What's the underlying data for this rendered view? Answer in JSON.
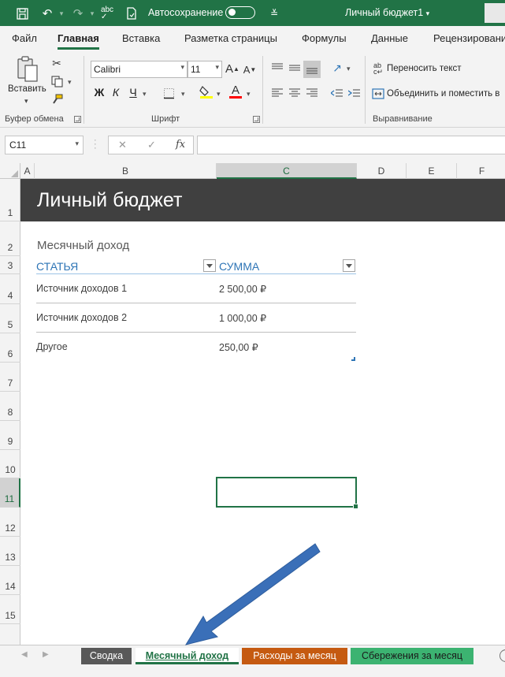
{
  "titlebar": {
    "autosave_label": "Автосохранение",
    "doc_title": "Личный бюджет1",
    "doc_title_chevron": "▾"
  },
  "ribbon_tabs": [
    "Файл",
    "Главная",
    "Вставка",
    "Разметка страницы",
    "Формулы",
    "Данные",
    "Рецензирование"
  ],
  "clipboard": {
    "paste_label": "Вставить",
    "group_label": "Буфер обмена"
  },
  "font": {
    "font_name": "Calibri",
    "font_size": "11",
    "grow": "A",
    "shrink": "A",
    "bold": "Ж",
    "italic": "К",
    "underline": "Ч",
    "group_label": "Шрифт",
    "fill_color": "#ffff00",
    "text_color": "#ff0000"
  },
  "alignment": {
    "wrap_text": "Переносить текст",
    "merge_center": "Объединить и поместить в",
    "group_label": "Выравнивание"
  },
  "formula_bar": {
    "name_box": "C11",
    "cancel": "✕",
    "enter": "✓",
    "fx": "fx",
    "formula": ""
  },
  "columns": [
    "A",
    "B",
    "C",
    "D",
    "E",
    "F"
  ],
  "selected_column": "C",
  "rows": [
    "1",
    "2",
    "3",
    "4",
    "5",
    "6",
    "7",
    "8",
    "9",
    "10",
    "11",
    "12",
    "13",
    "14",
    "15"
  ],
  "selected_row": "11",
  "sheet": {
    "title": "Личный бюджет",
    "subtitle": "Месячный доход",
    "headers": {
      "item": "СТАТЬЯ",
      "amount": "СУММА"
    },
    "rows": [
      {
        "item": "Источник доходов 1",
        "amount": "2 500,00 ₽"
      },
      {
        "item": "Источник доходов 2",
        "amount": "1 000,00 ₽"
      },
      {
        "item": "Другое",
        "amount": "250,00 ₽"
      }
    ]
  },
  "sheet_tabs": [
    {
      "label": "Сводка",
      "color": "#595959"
    },
    {
      "label": "Месячный доход",
      "color": "#ffffff"
    },
    {
      "label": "Расходы за месяц",
      "color": "#c55a11"
    },
    {
      "label": "Сбережения за месяц",
      "color": "#3cb371"
    }
  ],
  "active_sheet": "Месячный доход",
  "annotation_arrow_color": "#3a6fb8",
  "theme": {
    "excel_green": "#217346",
    "banner": "#404040",
    "header_blue": "#2e75b6"
  }
}
